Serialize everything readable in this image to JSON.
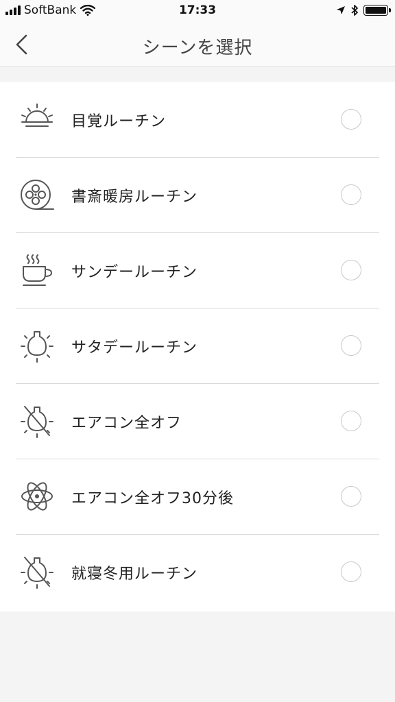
{
  "status_bar": {
    "carrier": "SoftBank",
    "time": "17:33"
  },
  "header": {
    "title": "シーンを選択",
    "back_icon": "chevron-left-icon"
  },
  "scenes": [
    {
      "label": "目覚ルーチン",
      "icon": "sunrise-icon",
      "selected": false
    },
    {
      "label": "書斎暖房ルーチン",
      "icon": "film-reel-icon",
      "selected": false
    },
    {
      "label": "サンデールーチン",
      "icon": "coffee-cup-icon",
      "selected": false
    },
    {
      "label": "サタデールーチン",
      "icon": "sun-bulb-icon",
      "selected": false
    },
    {
      "label": "エアコン全オフ",
      "icon": "sun-off-icon",
      "selected": false
    },
    {
      "label": "エアコン全オフ30分後",
      "icon": "atom-icon",
      "selected": false
    },
    {
      "label": "就寝冬用ルーチン",
      "icon": "sun-off-icon",
      "selected": false
    }
  ]
}
